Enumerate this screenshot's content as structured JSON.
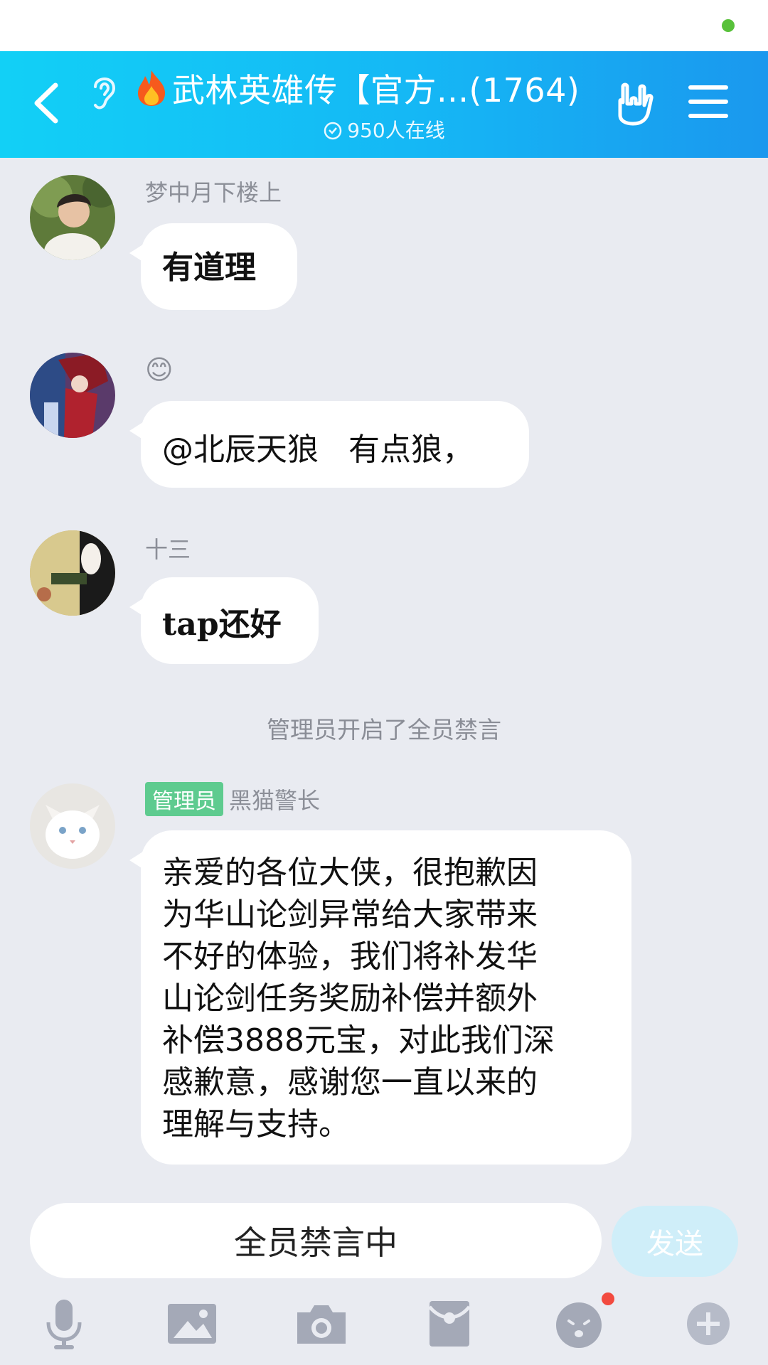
{
  "header": {
    "title": "武林英雄传【官方...(1764)",
    "online": "950人在线"
  },
  "messages": [
    {
      "sender": "梦中月下楼上",
      "text": "有道理"
    },
    {
      "sender": "😊",
      "text": "@北辰天狼   有点狼，"
    },
    {
      "sender": "十三",
      "text": "tap还好"
    }
  ],
  "system_notice": "管理员开启了全员禁言",
  "admin_message": {
    "badge": "管理员",
    "sender": "黑猫警长",
    "lines": [
      "亲爱的各位大侠，很抱歉因",
      "为华山论剑异常给大家带来",
      "不好的体验，我们将补发华",
      "山论剑任务奖励补偿并额外",
      "补偿3888元宝，对此我们深",
      "感歉意，感谢您一直以来的",
      "理解与支持。"
    ]
  },
  "input": {
    "status": "全员禁言中",
    "send_label": "发送"
  },
  "colors": {
    "header_start": "#12d0f6",
    "header_end": "#1a98ee",
    "admin_badge": "#5ecb8f",
    "send_disabled": "#cfeef9"
  },
  "toolbar_icons": [
    "microphone-icon",
    "image-icon",
    "camera-icon",
    "red-packet-icon",
    "emoji-icon",
    "plus-icon"
  ]
}
